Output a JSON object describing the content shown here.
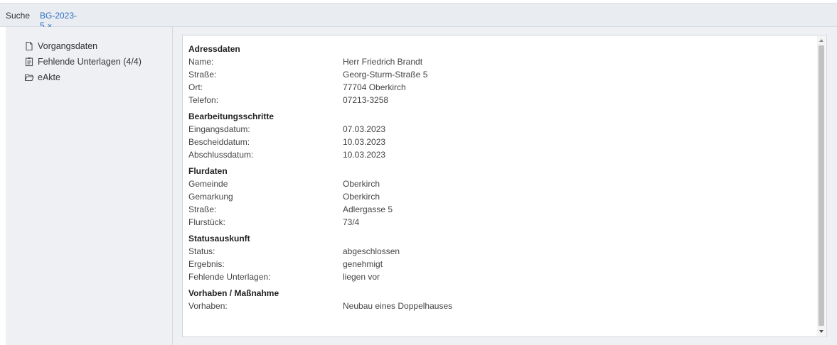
{
  "tabs": {
    "search_label": "Suche",
    "active_label": "BG-2023-5",
    "close_glyph": "×"
  },
  "sidebar": {
    "items": [
      {
        "label": "Vorgangsdaten",
        "icon": "file-icon"
      },
      {
        "label": "Fehlende Unterlagen (4/4)",
        "icon": "clipboard-icon"
      },
      {
        "label": "eAkte",
        "icon": "folder-open-icon"
      }
    ]
  },
  "sections": [
    {
      "title": "Adressdaten",
      "rows": [
        {
          "label": "Name:",
          "value": "Herr Friedrich Brandt"
        },
        {
          "label": "Straße:",
          "value": "Georg-Sturm-Straße 5"
        },
        {
          "label": "Ort:",
          "value": "77704 Oberkirch"
        },
        {
          "label": "Telefon:",
          "value": "07213-3258"
        }
      ]
    },
    {
      "title": "Bearbeitungsschritte",
      "rows": [
        {
          "label": "Eingangsdatum:",
          "value": "07.03.2023"
        },
        {
          "label": "Bescheiddatum:",
          "value": "10.03.2023"
        },
        {
          "label": "Abschlussdatum:",
          "value": "10.03.2023"
        }
      ]
    },
    {
      "title": "Flurdaten",
      "rows": [
        {
          "label": "Gemeinde",
          "value": "Oberkirch"
        },
        {
          "label": "Gemarkung",
          "value": "Oberkirch"
        },
        {
          "label": "Straße:",
          "value": "Adlergasse 5"
        },
        {
          "label": "Flurstück:",
          "value": "73/4"
        }
      ]
    },
    {
      "title": "Statusauskunft",
      "rows": [
        {
          "label": "Status:",
          "value": "abgeschlossen"
        },
        {
          "label": "Ergebnis:",
          "value": "genehmigt"
        },
        {
          "label": "Fehlende Unterlagen:",
          "value": "liegen vor"
        }
      ]
    },
    {
      "title": "Vorhaben / Maßnahme",
      "rows": [
        {
          "label": "Vorhaben:",
          "value": "Neubau eines Doppelhauses"
        }
      ]
    }
  ],
  "colors": {
    "accent": "#2d6fbf",
    "sidebar_bg": "#eef0f4",
    "tabbar_bg": "#e9ecf1"
  }
}
